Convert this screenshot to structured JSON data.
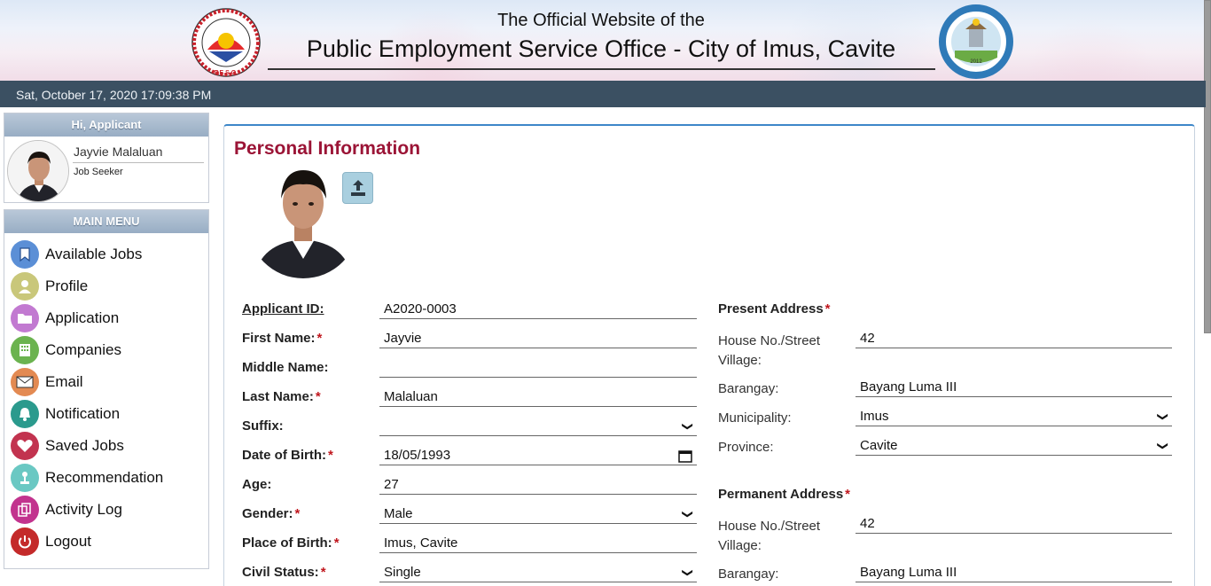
{
  "header": {
    "subtitle": "The Official Website of the",
    "title": "Public Employment Service Office - City of Imus, Cavite",
    "peso_logo_text": "PUBLIC EMPLOYMENT SERVICE OFFICE · P.E.S.O.",
    "imus_logo_text": "LUNGSOD NG IMUS · LALAWIGAN NG CAVITE · 2012"
  },
  "datetime": "Sat, October 17, 2020 17:09:38 PM",
  "user_panel": {
    "title": "Hi, Applicant",
    "name": "Jayvie Malaluan",
    "role": "Job Seeker"
  },
  "menu": {
    "title": "MAIN MENU",
    "items": [
      {
        "label": "Available Jobs",
        "icon": "bookmark-icon",
        "color": "#5b8fd6"
      },
      {
        "label": "Profile",
        "icon": "user-icon",
        "color": "#c9c77a"
      },
      {
        "label": "Application",
        "icon": "folder-icon",
        "color": "#c27ad1"
      },
      {
        "label": "Companies",
        "icon": "building-icon",
        "color": "#6bb34f"
      },
      {
        "label": "Email",
        "icon": "envelope-icon",
        "color": "#e38a52"
      },
      {
        "label": "Notification",
        "icon": "bell-icon",
        "color": "#2b9a8d"
      },
      {
        "label": "Saved Jobs",
        "icon": "heart-icon",
        "color": "#c2334f"
      },
      {
        "label": "Recommendation",
        "icon": "award-icon",
        "color": "#6ac8c3"
      },
      {
        "label": "Activity Log",
        "icon": "copy-icon",
        "color": "#c2338e"
      },
      {
        "label": "Logout",
        "icon": "power-icon",
        "color": "#c42a2a"
      }
    ]
  },
  "personal": {
    "title": "Personal Information",
    "applicant_id_label": "Applicant ID:",
    "applicant_id": "A2020-0003",
    "first_name_label": "First Name:",
    "first_name": "Jayvie",
    "middle_name_label": "Middle Name:",
    "middle_name": "",
    "last_name_label": "Last Name:",
    "last_name": "Malaluan",
    "suffix_label": "Suffix:",
    "suffix": "",
    "dob_label": "Date of Birth:",
    "dob": "18/05/1993",
    "age_label": "Age:",
    "age": "27",
    "gender_label": "Gender:",
    "gender": "Male",
    "pob_label": "Place of Birth:",
    "pob": "Imus, Cavite",
    "civil_label": "Civil Status:",
    "civil": "Single"
  },
  "present_address": {
    "title": "Present Address",
    "house_label_1": "House No./Street",
    "house_label_2": "Village:",
    "house": "42",
    "barangay_label": "Barangay:",
    "barangay": "Bayang Luma III",
    "municipality_label": "Municipality:",
    "municipality": "Imus",
    "province_label": "Province:",
    "province": "Cavite"
  },
  "permanent_address": {
    "title": "Permanent Address",
    "house_label_1": "House No./Street",
    "house_label_2": "Village:",
    "house": "42",
    "barangay_label": "Barangay:",
    "barangay": "Bayang Luma III"
  }
}
